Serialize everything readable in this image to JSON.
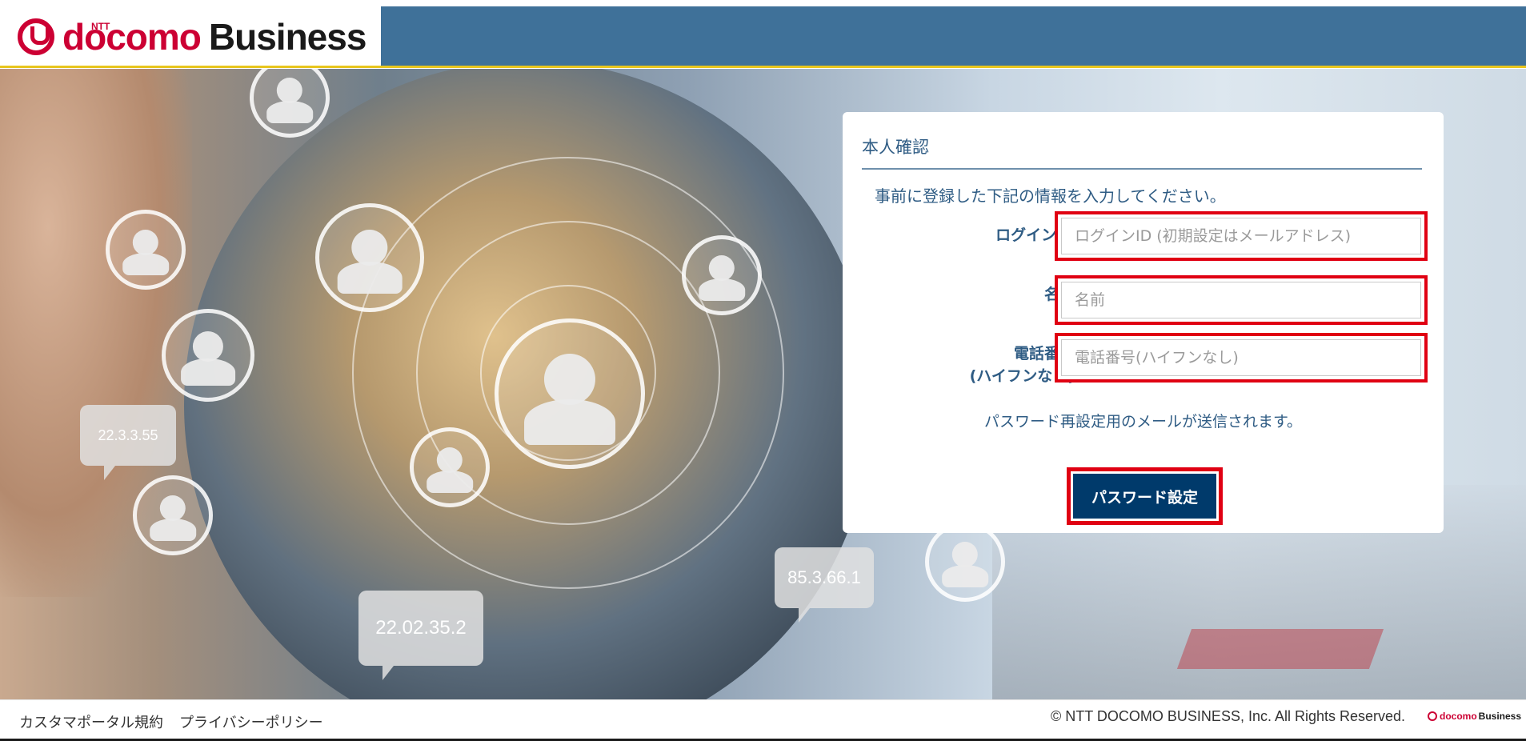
{
  "brand": {
    "ntt": "NTT",
    "docomo": "docomo",
    "business": "Business",
    "colors": {
      "header_band": "#3f7199",
      "accent_yellow": "#e8c61e",
      "brand_red": "#cc0033",
      "primary_button": "#003a6b",
      "highlight_red": "#e00012"
    }
  },
  "background": {
    "bubbles": [
      "22.3.3.55",
      "22.02.35.2",
      "85.3.66.1"
    ]
  },
  "card": {
    "title": "本人確認",
    "intro": "事前に登録した下記の情報を入力してください。",
    "fields": {
      "login_id": {
        "label": "ログインID",
        "value": "",
        "placeholder": "ログインID (初期設定はメールアドレス)"
      },
      "name": {
        "label": "名前",
        "value": "",
        "placeholder": "名前"
      },
      "phone": {
        "label_line1": "電話番号",
        "label_line2": "(ハイフンなし)",
        "value": "",
        "placeholder": "電話番号(ハイフンなし)"
      }
    },
    "note": "パスワード再設定用のメールが送信されます。",
    "submit_label": "パスワード設定"
  },
  "footer": {
    "links": [
      "カスタマポータル規約",
      "プライバシーポリシー"
    ],
    "copyright": "© NTT DOCOMO BUSINESS, Inc. All Rights Reserved.",
    "logo_docomo": "docomo",
    "logo_business": "Business"
  }
}
